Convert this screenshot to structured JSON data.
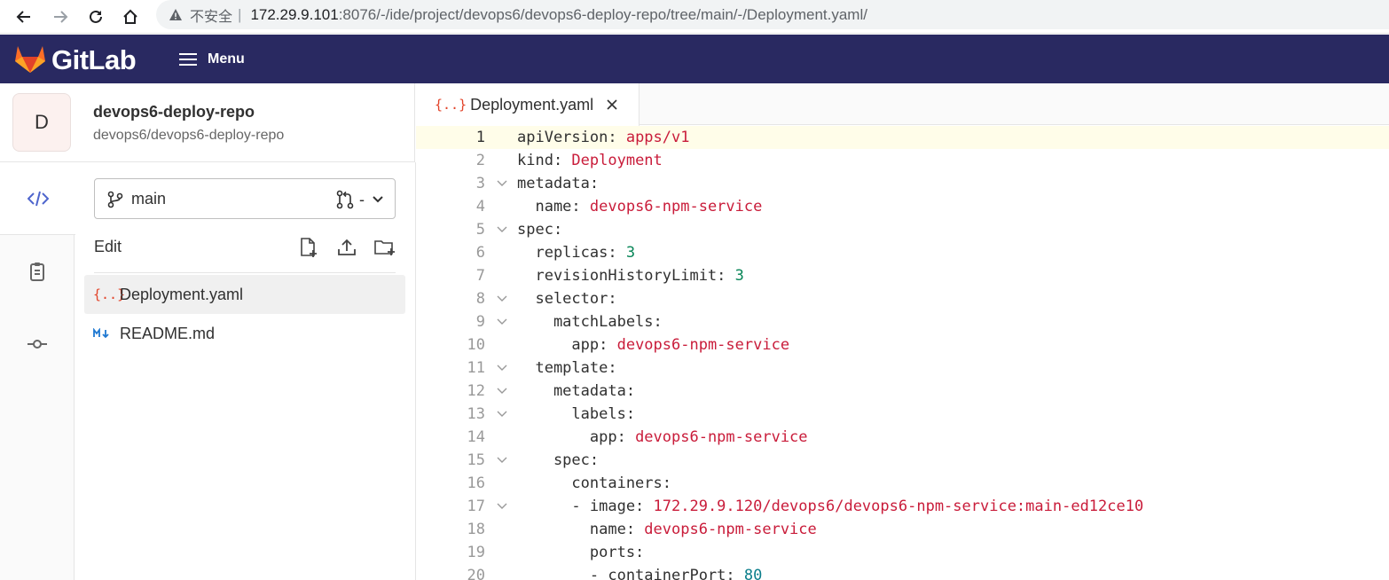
{
  "browser": {
    "security_label": "不安全",
    "separator": "|",
    "url_host": "172.29.9.101",
    "url_rest": ":8076/-/ide/project/devops6/devops6-deploy-repo/tree/main/-/Deployment.yaml/"
  },
  "header": {
    "brand": "GitLab",
    "menu_label": "Menu",
    "background_color": "#292961"
  },
  "project": {
    "avatar_letter": "D",
    "name": "devops6-deploy-repo",
    "path": "devops6/devops6-deploy-repo"
  },
  "activity_bar": {
    "items": [
      {
        "icon": "code-icon",
        "active": true
      },
      {
        "icon": "clipboard-icon",
        "active": false
      },
      {
        "icon": "commit-icon",
        "active": false
      }
    ]
  },
  "file_panel": {
    "branch": "main",
    "merge_request": "-",
    "edit_label": "Edit",
    "files": [
      {
        "name": "Deployment.yaml",
        "icon": "yaml-icon",
        "icon_text": "{..}",
        "active": true
      },
      {
        "name": "README.md",
        "icon": "markdown-icon",
        "active": false
      }
    ]
  },
  "editor": {
    "tab": {
      "label": "Deployment.yaml",
      "icon_text": "{..}"
    },
    "current_line": 1,
    "lines": [
      {
        "n": "1",
        "fold": false,
        "indent": "",
        "key": "apiVersion:",
        "value": "apps/v1",
        "vtype": "str"
      },
      {
        "n": "2",
        "fold": false,
        "indent": "",
        "key": "kind:",
        "value": "Deployment",
        "vtype": "str"
      },
      {
        "n": "3",
        "fold": true,
        "indent": "",
        "key": "metadata:",
        "value": "",
        "vtype": ""
      },
      {
        "n": "4",
        "fold": false,
        "indent": "  ",
        "key": "name:",
        "value": "devops6-npm-service",
        "vtype": "str"
      },
      {
        "n": "5",
        "fold": true,
        "indent": "",
        "key": "spec:",
        "value": "",
        "vtype": ""
      },
      {
        "n": "6",
        "fold": false,
        "indent": "  ",
        "key": "replicas:",
        "value": "3",
        "vtype": "num"
      },
      {
        "n": "7",
        "fold": false,
        "indent": "  ",
        "key": "revisionHistoryLimit:",
        "value": "3",
        "vtype": "num"
      },
      {
        "n": "8",
        "fold": true,
        "indent": "  ",
        "key": "selector:",
        "value": "",
        "vtype": ""
      },
      {
        "n": "9",
        "fold": true,
        "indent": "    ",
        "key": "matchLabels:",
        "value": "",
        "vtype": ""
      },
      {
        "n": "10",
        "fold": false,
        "indent": "      ",
        "key": "app:",
        "value": "devops6-npm-service",
        "vtype": "str"
      },
      {
        "n": "11",
        "fold": true,
        "indent": "  ",
        "key": "template:",
        "value": "",
        "vtype": ""
      },
      {
        "n": "12",
        "fold": true,
        "indent": "    ",
        "key": "metadata:",
        "value": "",
        "vtype": ""
      },
      {
        "n": "13",
        "fold": true,
        "indent": "      ",
        "key": "labels:",
        "value": "",
        "vtype": ""
      },
      {
        "n": "14",
        "fold": false,
        "indent": "        ",
        "key": "app:",
        "value": "devops6-npm-service",
        "vtype": "str"
      },
      {
        "n": "15",
        "fold": true,
        "indent": "    ",
        "key": "spec:",
        "value": "",
        "vtype": ""
      },
      {
        "n": "16",
        "fold": false,
        "indent": "      ",
        "key": "containers:",
        "value": "",
        "vtype": ""
      },
      {
        "n": "17",
        "fold": true,
        "indent": "      ",
        "key": "- image:",
        "value": "172.29.9.120/devops6/devops6-npm-service:main-ed12ce10",
        "vtype": "str"
      },
      {
        "n": "18",
        "fold": false,
        "indent": "        ",
        "key": "name:",
        "value": "devops6-npm-service",
        "vtype": "str"
      },
      {
        "n": "19",
        "fold": false,
        "indent": "        ",
        "key": "ports:",
        "value": "",
        "vtype": ""
      },
      {
        "n": "20",
        "fold": false,
        "indent": "        ",
        "key": "- containerPort:",
        "value": "80",
        "vtype": "num2"
      }
    ]
  }
}
